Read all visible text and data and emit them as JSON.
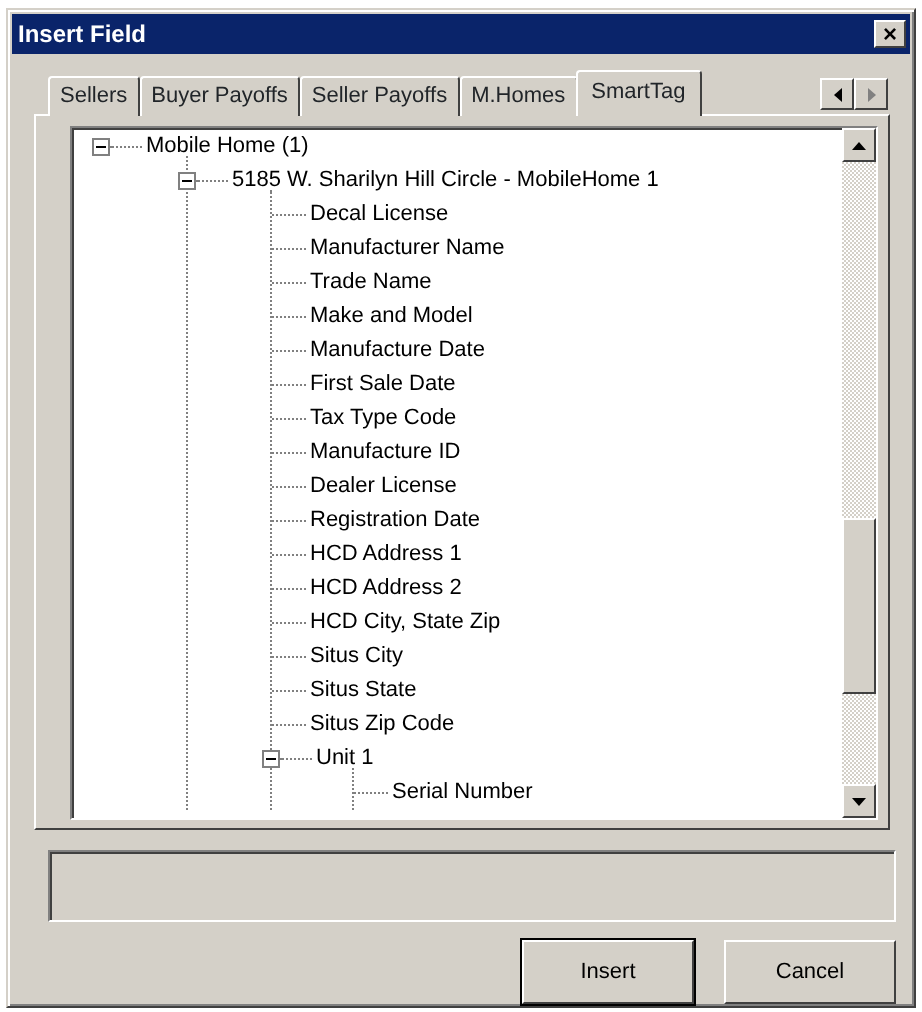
{
  "window": {
    "title": "Insert Field",
    "close": "×"
  },
  "tabs": [
    {
      "label": "Sellers",
      "selected": false
    },
    {
      "label": "Buyer Payoffs",
      "selected": false
    },
    {
      "label": "Seller Payoffs",
      "selected": false
    },
    {
      "label": "M.Homes",
      "selected": false
    },
    {
      "label": "SmartTag",
      "selected": true
    }
  ],
  "tree": [
    {
      "label": "Mobile Home (1)",
      "expanded": true,
      "children": [
        {
          "label": "5185 W. Sharilyn Hill Circle - MobileHome 1",
          "expanded": true,
          "children": [
            {
              "label": "Decal License"
            },
            {
              "label": "Manufacturer Name"
            },
            {
              "label": "Trade Name"
            },
            {
              "label": "Make and Model"
            },
            {
              "label": "Manufacture Date"
            },
            {
              "label": "First Sale Date"
            },
            {
              "label": "Tax Type Code"
            },
            {
              "label": "Manufacture ID"
            },
            {
              "label": "Dealer License"
            },
            {
              "label": "Registration Date"
            },
            {
              "label": "HCD Address 1"
            },
            {
              "label": "HCD Address 2"
            },
            {
              "label": "HCD City, State Zip"
            },
            {
              "label": "Situs City"
            },
            {
              "label": "Situs State"
            },
            {
              "label": "Situs Zip Code"
            },
            {
              "label": "Unit 1",
              "expanded": true,
              "children": [
                {
                  "label": "Serial Number"
                }
              ]
            }
          ]
        }
      ]
    }
  ],
  "buttons": [
    {
      "label": "Insert",
      "default": true
    },
    {
      "label": "Cancel",
      "default": false
    }
  ]
}
